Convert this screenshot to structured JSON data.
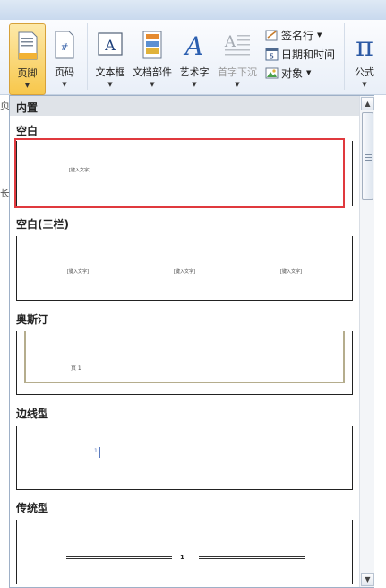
{
  "ribbon": {
    "footer_button": "页脚",
    "page_number_button": "页码",
    "textbox_button": "文本框",
    "quick_parts_button": "文档部件",
    "wordart_button": "艺术字",
    "drop_cap_button": "首字下沉",
    "signature_line": "签名行",
    "date_time": "日期和时间",
    "object": "对象",
    "equation_button": "公式"
  },
  "left_edge": {
    "top_fragment": "页",
    "mid_fragment": "长"
  },
  "gallery": {
    "category": "内置",
    "placeholder": "[键入文字]",
    "blank": {
      "title": "空白"
    },
    "blank_three_columns": {
      "title": "空白(三栏)"
    },
    "austin": {
      "title": "奥斯汀",
      "page_label": "页 1"
    },
    "edge_type": {
      "title": "边线型",
      "page_number": "1"
    },
    "traditional": {
      "title": "传统型",
      "page_number": "1"
    }
  },
  "colors": {
    "selection_highlight": "#e0393e",
    "active_button": "#f7c74b",
    "austin_border": "#b5ad8d",
    "edge_accent": "#5b7bbf"
  }
}
